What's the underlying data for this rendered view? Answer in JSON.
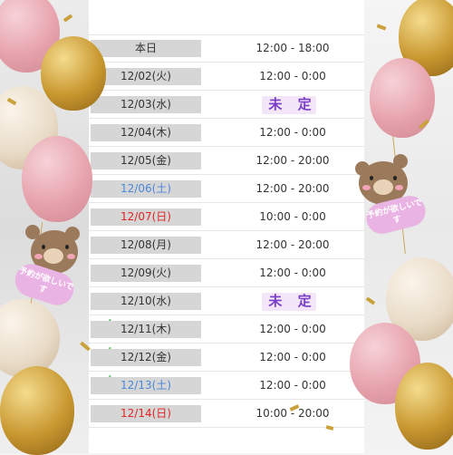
{
  "schedule": {
    "rows": [
      {
        "date": "本日",
        "hours": "12:00 - 18:00",
        "day_type": "weekday",
        "tbd": false,
        "icon": ""
      },
      {
        "date": "12/02(火)",
        "hours": "12:00 - 0:00",
        "day_type": "weekday",
        "tbd": false,
        "icon": ""
      },
      {
        "date": "12/03(水)",
        "hours": "未 定",
        "day_type": "weekday",
        "tbd": true,
        "icon": ""
      },
      {
        "date": "12/04(木)",
        "hours": "12:00 - 0:00",
        "day_type": "weekday",
        "tbd": false,
        "icon": ""
      },
      {
        "date": "12/05(金)",
        "hours": "12:00 - 20:00",
        "day_type": "weekday",
        "tbd": false,
        "icon": ""
      },
      {
        "date": "12/06(土)",
        "hours": "12:00 - 20:00",
        "day_type": "saturday",
        "tbd": false,
        "icon": ""
      },
      {
        "date": "12/07(日)",
        "hours": "10:00 - 0:00",
        "day_type": "sunday",
        "tbd": false,
        "icon": ""
      },
      {
        "date": "12/08(月)",
        "hours": "12:00 - 20:00",
        "day_type": "weekday",
        "tbd": false,
        "icon": ""
      },
      {
        "date": "12/09(火)",
        "hours": "12:00 - 0:00",
        "day_type": "weekday",
        "tbd": false,
        "icon": ""
      },
      {
        "date": "12/10(水)",
        "hours": "未 定",
        "day_type": "weekday",
        "tbd": true,
        "icon": ""
      },
      {
        "date": "12/11(木)",
        "hours": "12:00 - 0:00",
        "day_type": "weekday",
        "tbd": false,
        "icon": "party-popper-icon"
      },
      {
        "date": "12/12(金)",
        "hours": "12:00 - 0:00",
        "day_type": "weekday",
        "tbd": false,
        "icon": "party-popper-icon"
      },
      {
        "date": "12/13(土)",
        "hours": "12:00 - 0:00",
        "day_type": "saturday",
        "tbd": false,
        "icon": "party-popper-icon"
      },
      {
        "date": "12/14(日)",
        "hours": "10:00 - 20:00",
        "day_type": "sunday",
        "tbd": false,
        "icon": ""
      }
    ]
  },
  "stickers": {
    "left_bubble": "予約が欲しいです",
    "right_bubble": "予約が欲しいです"
  },
  "colors": {
    "saturday": "#4a86d8",
    "sunday": "#e02424",
    "tbd": "#7a3dc8",
    "balloon_pink": "#e7a3ad",
    "balloon_gold": "#c8972f",
    "balloon_cream": "#e9dcc8"
  }
}
